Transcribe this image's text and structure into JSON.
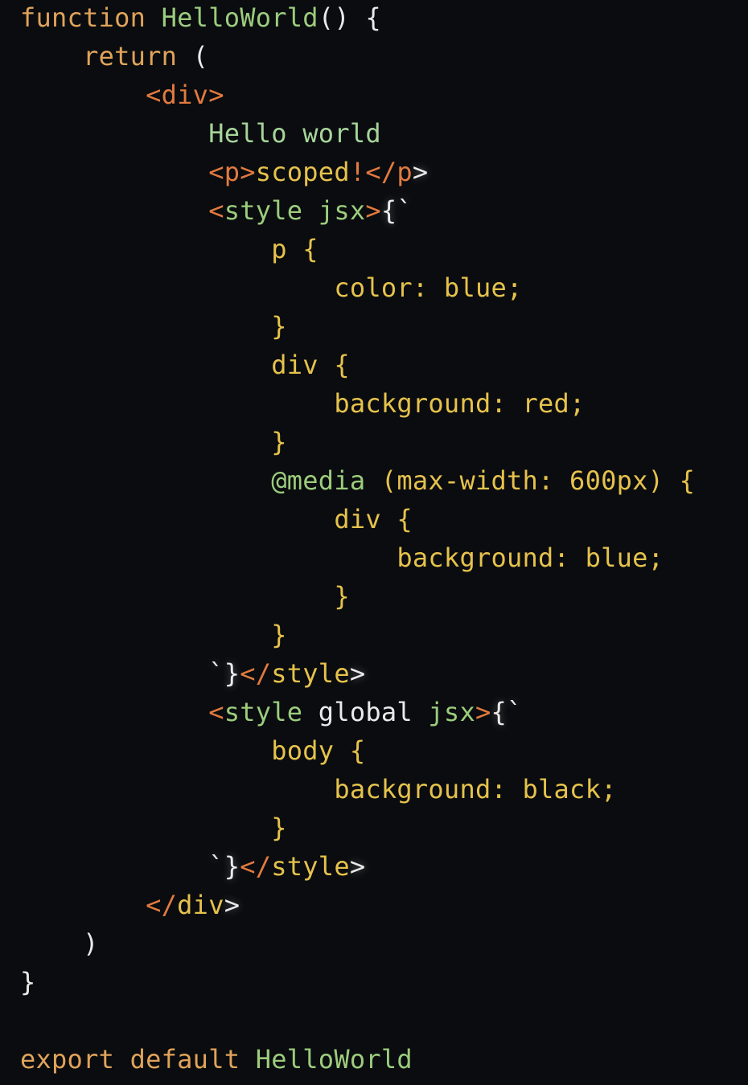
{
  "editor": {
    "language": "jsx",
    "colors": {
      "background": "#0a0c0f",
      "keyword": "#e0a35a",
      "function_name": "#9ccc7d",
      "tag": "#e27a3f",
      "jsx_attr": "#9ccc7d",
      "jsx_text": "#a7d49a",
      "css": "#e6c24c",
      "punctuation": "#eaeaea"
    },
    "lines": [
      [
        {
          "t": "kw",
          "v": "function"
        },
        {
          "t": "mut",
          "v": " "
        },
        {
          "t": "fn",
          "v": "HelloWorld"
        },
        {
          "t": "mut",
          "v": "() {"
        }
      ],
      [
        {
          "t": "mut",
          "v": "    "
        },
        {
          "t": "kw",
          "v": "return"
        },
        {
          "t": "mut",
          "v": " ("
        }
      ],
      [
        {
          "t": "mut",
          "v": "        "
        },
        {
          "t": "tag",
          "v": "<div>"
        }
      ],
      [
        {
          "t": "mut",
          "v": "            "
        },
        {
          "t": "txt",
          "v": "Hello world"
        }
      ],
      [
        {
          "t": "mut",
          "v": "            "
        },
        {
          "t": "tag",
          "v": "<p>"
        },
        {
          "t": "css",
          "v": "scoped"
        },
        {
          "t": "tag",
          "v": "!</p"
        },
        {
          "t": "mut",
          "v": ">"
        }
      ],
      [
        {
          "t": "mut",
          "v": "            "
        },
        {
          "t": "tag",
          "v": "<"
        },
        {
          "t": "jsx",
          "v": "style jsx"
        },
        {
          "t": "tag",
          "v": ">"
        },
        {
          "t": "mut",
          "v": "{`"
        }
      ],
      [
        {
          "t": "mut",
          "v": "                "
        },
        {
          "t": "css",
          "v": "p {"
        }
      ],
      [
        {
          "t": "mut",
          "v": "                    "
        },
        {
          "t": "css",
          "v": "color: blue;"
        }
      ],
      [
        {
          "t": "mut",
          "v": "                "
        },
        {
          "t": "css",
          "v": "}"
        }
      ],
      [
        {
          "t": "mut",
          "v": "                "
        },
        {
          "t": "css",
          "v": "div {"
        }
      ],
      [
        {
          "t": "mut",
          "v": "                    "
        },
        {
          "t": "css",
          "v": "background: red;"
        }
      ],
      [
        {
          "t": "mut",
          "v": "                "
        },
        {
          "t": "css",
          "v": "}"
        }
      ],
      [
        {
          "t": "mut",
          "v": "                "
        },
        {
          "t": "jsx",
          "v": "@media"
        },
        {
          "t": "css",
          "v": " (max-width: 600px) {"
        }
      ],
      [
        {
          "t": "mut",
          "v": "                    "
        },
        {
          "t": "css",
          "v": "div {"
        }
      ],
      [
        {
          "t": "mut",
          "v": "                        "
        },
        {
          "t": "css",
          "v": "background: blue;"
        }
      ],
      [
        {
          "t": "mut",
          "v": "                    "
        },
        {
          "t": "css",
          "v": "}"
        }
      ],
      [
        {
          "t": "mut",
          "v": "                "
        },
        {
          "t": "css",
          "v": "}"
        }
      ],
      [
        {
          "t": "mut",
          "v": "            `}"
        },
        {
          "t": "tag",
          "v": "</"
        },
        {
          "t": "css",
          "v": "style"
        },
        {
          "t": "mut",
          "v": ">"
        }
      ],
      [
        {
          "t": "mut",
          "v": "            "
        },
        {
          "t": "tag",
          "v": "<"
        },
        {
          "t": "jsx",
          "v": "style"
        },
        {
          "t": "mut",
          "v": " global "
        },
        {
          "t": "jsx",
          "v": "jsx"
        },
        {
          "t": "tag",
          "v": ">"
        },
        {
          "t": "mut",
          "v": "{`"
        }
      ],
      [
        {
          "t": "mut",
          "v": "                "
        },
        {
          "t": "css",
          "v": "body {"
        }
      ],
      [
        {
          "t": "mut",
          "v": "                    "
        },
        {
          "t": "css",
          "v": "background: black;"
        }
      ],
      [
        {
          "t": "mut",
          "v": "                "
        },
        {
          "t": "css",
          "v": "}"
        }
      ],
      [
        {
          "t": "mut",
          "v": "            `}"
        },
        {
          "t": "tag",
          "v": "</"
        },
        {
          "t": "css",
          "v": "style"
        },
        {
          "t": "mut",
          "v": ">"
        }
      ],
      [
        {
          "t": "mut",
          "v": "        "
        },
        {
          "t": "tag",
          "v": "</"
        },
        {
          "t": "css",
          "v": "div"
        },
        {
          "t": "mut",
          "v": ">"
        }
      ],
      [
        {
          "t": "mut",
          "v": "    )"
        }
      ],
      [
        {
          "t": "mut",
          "v": "}"
        }
      ],
      [
        {
          "t": "mut",
          "v": ""
        }
      ],
      [
        {
          "t": "kw",
          "v": "export"
        },
        {
          "t": "mut",
          "v": " "
        },
        {
          "t": "kw",
          "v": "default"
        },
        {
          "t": "mut",
          "v": " "
        },
        {
          "t": "fn",
          "v": "HelloWorld"
        }
      ]
    ]
  }
}
